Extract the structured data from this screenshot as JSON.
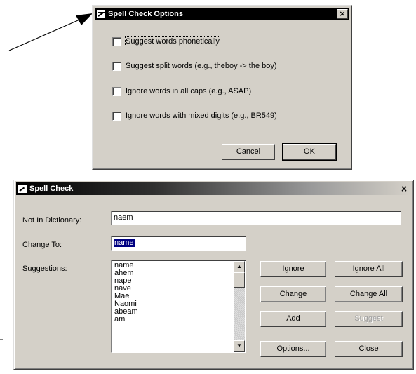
{
  "options_dialog": {
    "title": "Spell Check Options",
    "close_glyph": "×",
    "checkboxes": [
      {
        "label": "Suggest words phonetically",
        "checked": false
      },
      {
        "label": "Suggest split words (e.g., theboy -> the boy)",
        "checked": false
      },
      {
        "label": "Ignore words in all caps (e.g., ASAP)",
        "checked": false
      },
      {
        "label": "Ignore words with mixed digits (e.g., BR549)",
        "checked": false
      }
    ],
    "cancel_label": "Cancel",
    "ok_label": "OK"
  },
  "spell_dialog": {
    "title": "Spell Check",
    "close_glyph": "×",
    "not_in_dictionary_label": "Not In Dictionary:",
    "not_in_dictionary_value": "naem",
    "change_to_label": "Change To:",
    "change_to_value": "name",
    "suggestions_label": "Suggestions:",
    "suggestions": [
      "name",
      "ahem",
      "nape",
      "nave",
      "Mae",
      "Naomi",
      "abeam",
      "am"
    ],
    "buttons": {
      "ignore": "Ignore",
      "ignore_all": "Ignore All",
      "change": "Change",
      "change_all": "Change All",
      "add": "Add",
      "suggest": "Suggest",
      "options": "Options...",
      "close": "Close"
    }
  },
  "icons": {
    "scroll_up": "▲",
    "scroll_down": "▼"
  }
}
